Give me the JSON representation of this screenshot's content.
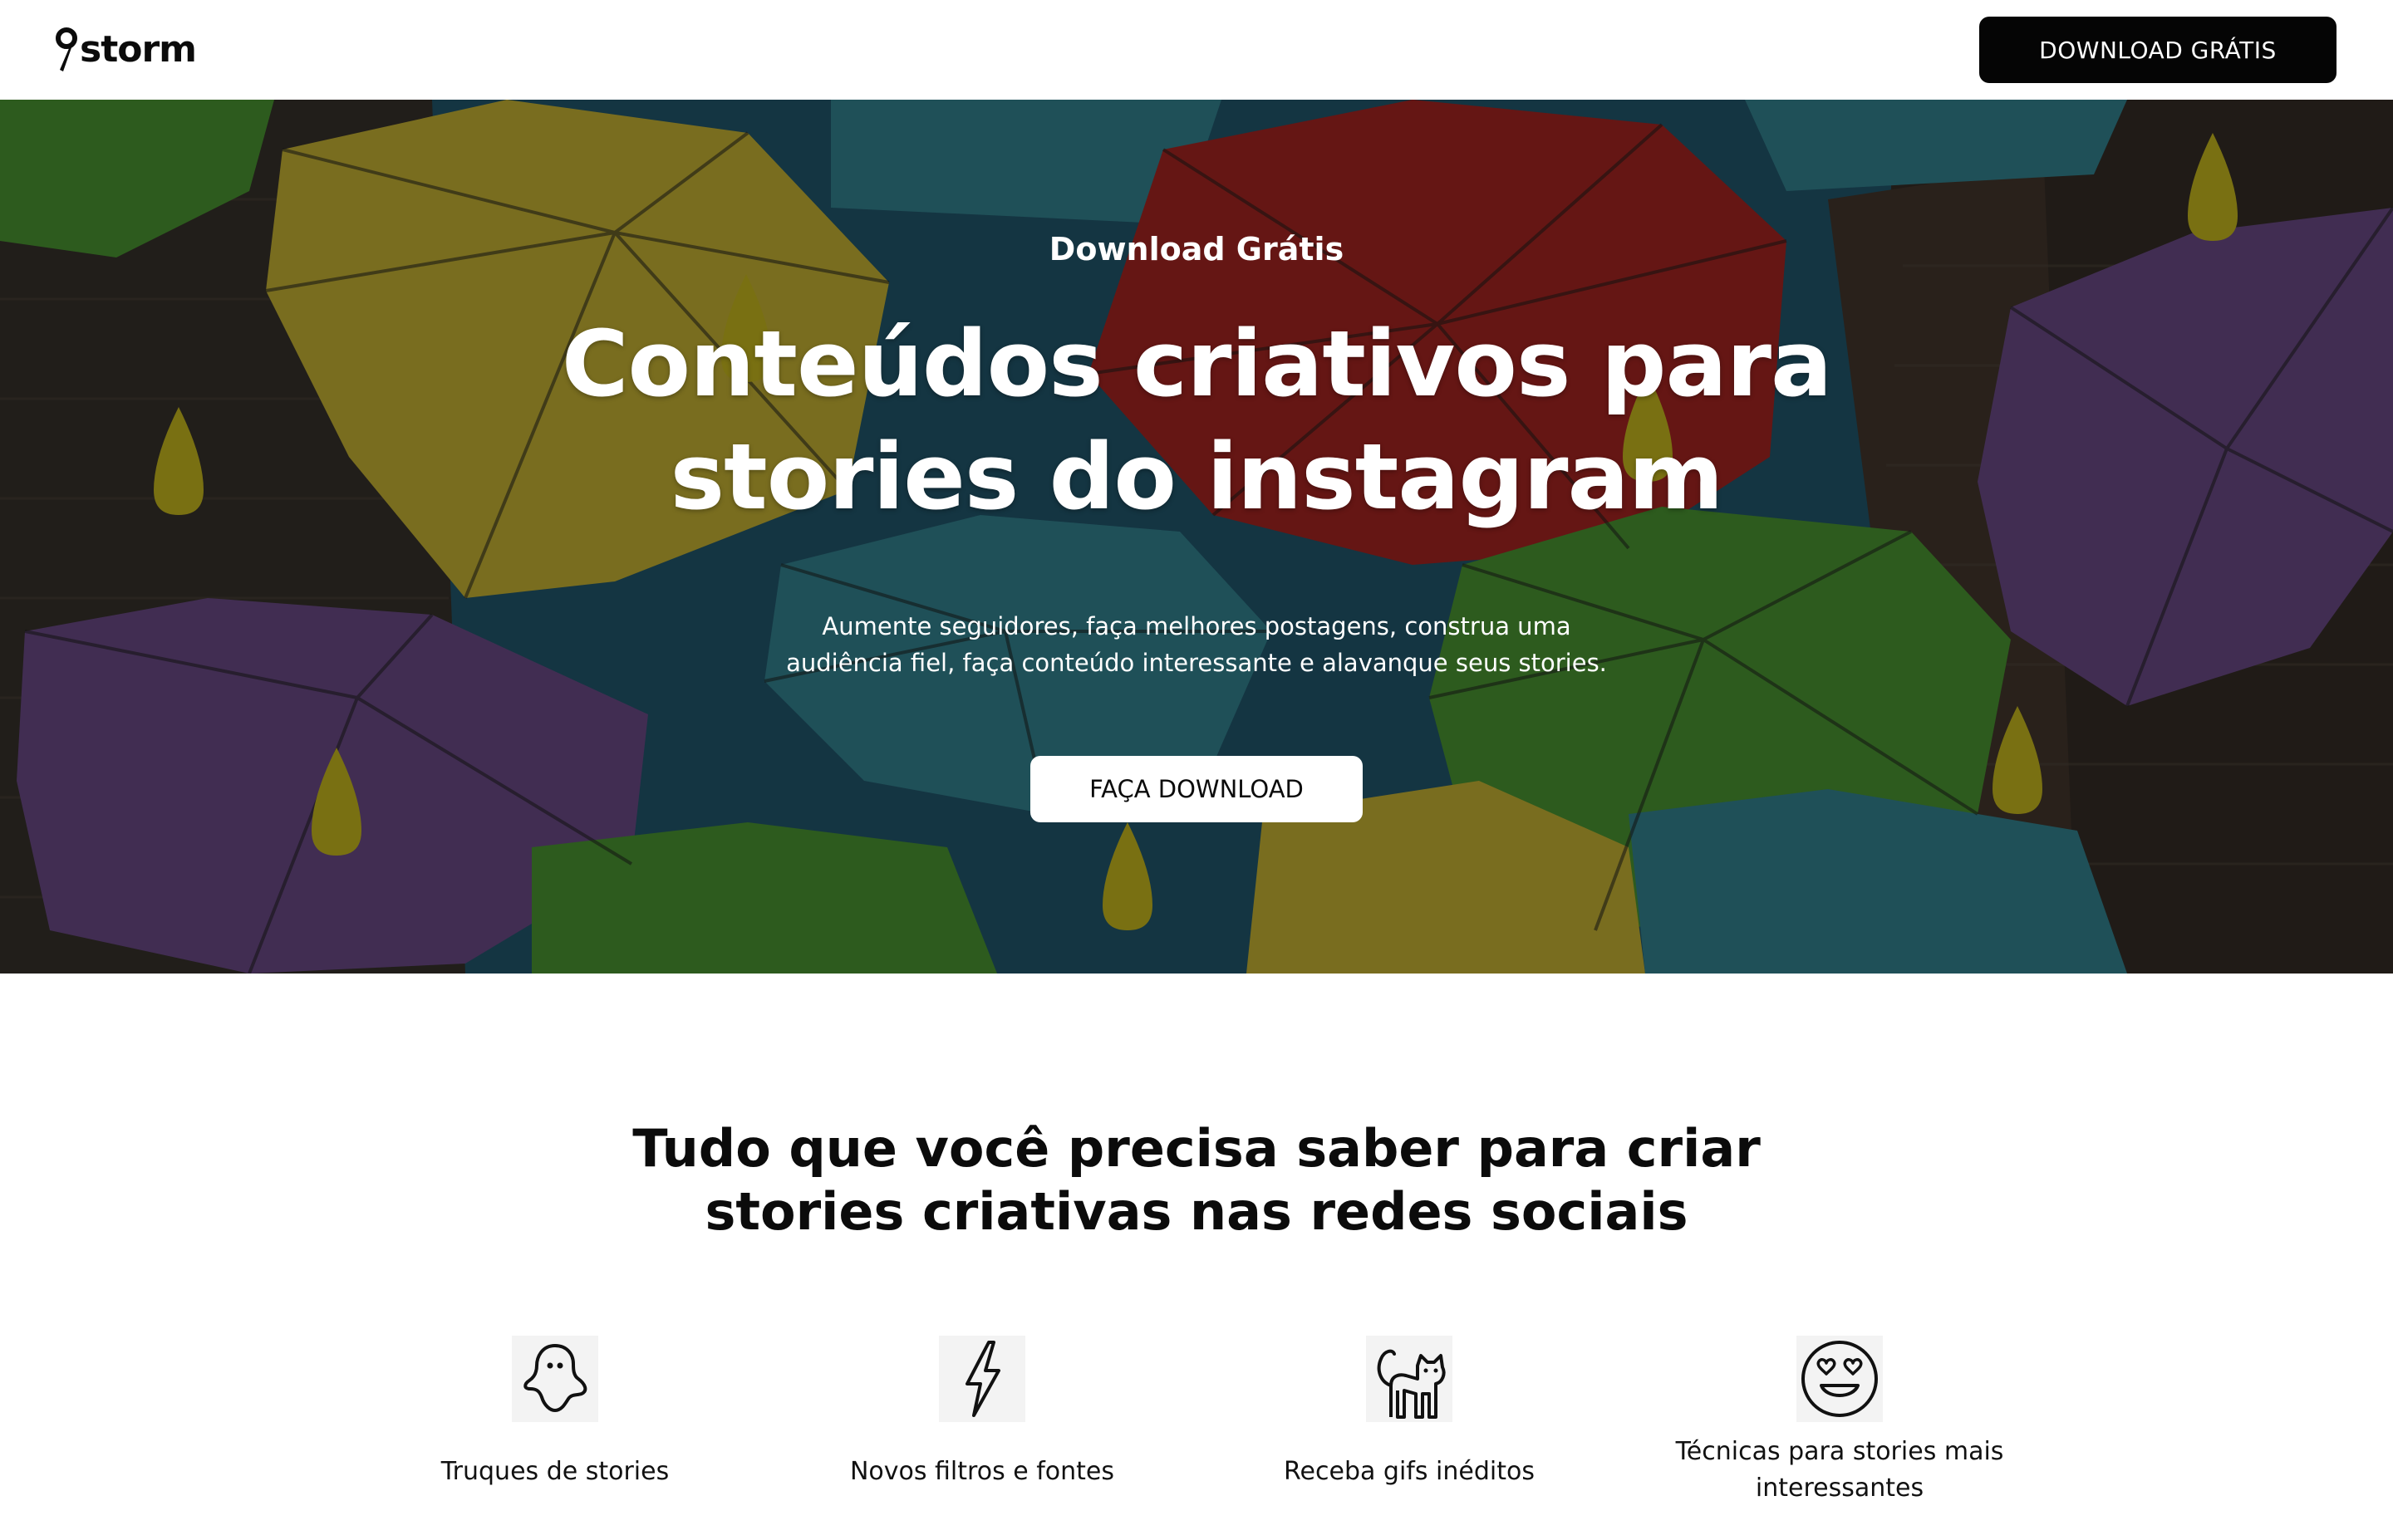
{
  "nav": {
    "logo_text": "storm",
    "cta_label": "DOWNLOAD GRÁTIS"
  },
  "hero": {
    "eyebrow": "Download Grátis",
    "title_line1": "Conteúdos criativos para",
    "title_line2": "stories do instagram",
    "subtitle_line1": "Aumente seguidores, faça melhores postagens, construa uma",
    "subtitle_line2": "audiência fiel, faça conteúdo interessante e alavanque seus stories.",
    "cta_label": "FAÇA DOWNLOAD"
  },
  "features": {
    "title_line1": "Tudo que você precisa saber para criar",
    "title_line2": "stories criativas nas redes sociais",
    "items": [
      {
        "icon": "ghost-icon",
        "label": "Truques de stories"
      },
      {
        "icon": "lightning-icon",
        "label": "Novos filtros e fontes"
      },
      {
        "icon": "cat-icon",
        "label": "Receba gifs inéditos"
      },
      {
        "icon": "heart-eyes-icon",
        "label_line1": "Técnicas para stories mais",
        "label_line2": "interessantes"
      }
    ]
  },
  "colors": {
    "dark_button": "#050505",
    "hero_sky": "#1d4a5c",
    "umbrella_yellow": "#a8972c",
    "umbrella_red": "#8c1f1c",
    "umbrella_green": "#3f7f2a",
    "umbrella_purple": "#5a3f72",
    "umbrella_teal": "#2b6f7a"
  }
}
